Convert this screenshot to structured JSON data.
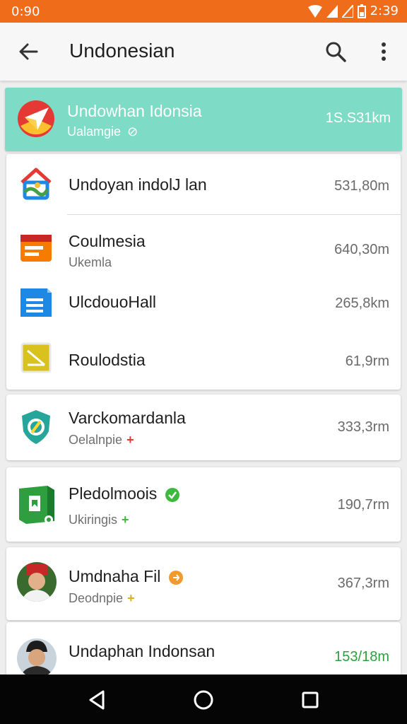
{
  "status_bar": {
    "time_left": "0:90",
    "time_right": "2:39"
  },
  "app_bar": {
    "title": "Undonesian"
  },
  "list": {
    "highlighted": {
      "name": "Undowhan Idonsia",
      "subtitle": "Ualamgie",
      "distance": "1S.S31km"
    },
    "items": [
      {
        "name": "Undoyan indolJ lan",
        "subtitle": "",
        "distance": "531,80m"
      },
      {
        "name": "Coulmesia",
        "subtitle": "Ukemla",
        "distance": "640,30m"
      },
      {
        "name": "UlcdouoHall",
        "subtitle": "",
        "distance": "265,8km"
      },
      {
        "name": "Roulodstia",
        "subtitle": "",
        "distance": "61,9rm"
      },
      {
        "name": "Varckomardanla",
        "subtitle": "Oelalnpie",
        "distance": "333,3rm"
      },
      {
        "name": "Pledolmoois",
        "subtitle": "Ukiringis",
        "distance": "190,7rm"
      },
      {
        "name": "Umdnaha Fil",
        "subtitle": "Deodnpie",
        "distance": "367,3rm"
      },
      {
        "name": "Undaphan Indonsan",
        "subtitle": "",
        "distance": "153/18m"
      }
    ]
  },
  "colors": {
    "status_bar": "#ef6c1a",
    "highlight": "#7edbc5",
    "verified_green": "#3db93d",
    "badge_orange": "#f29a2e",
    "distance_green": "#2e9e3e"
  },
  "icons": [
    "back-arrow-icon",
    "search-icon",
    "more-vert-icon",
    "nav-back-icon",
    "nav-home-icon",
    "nav-recents-icon"
  ]
}
